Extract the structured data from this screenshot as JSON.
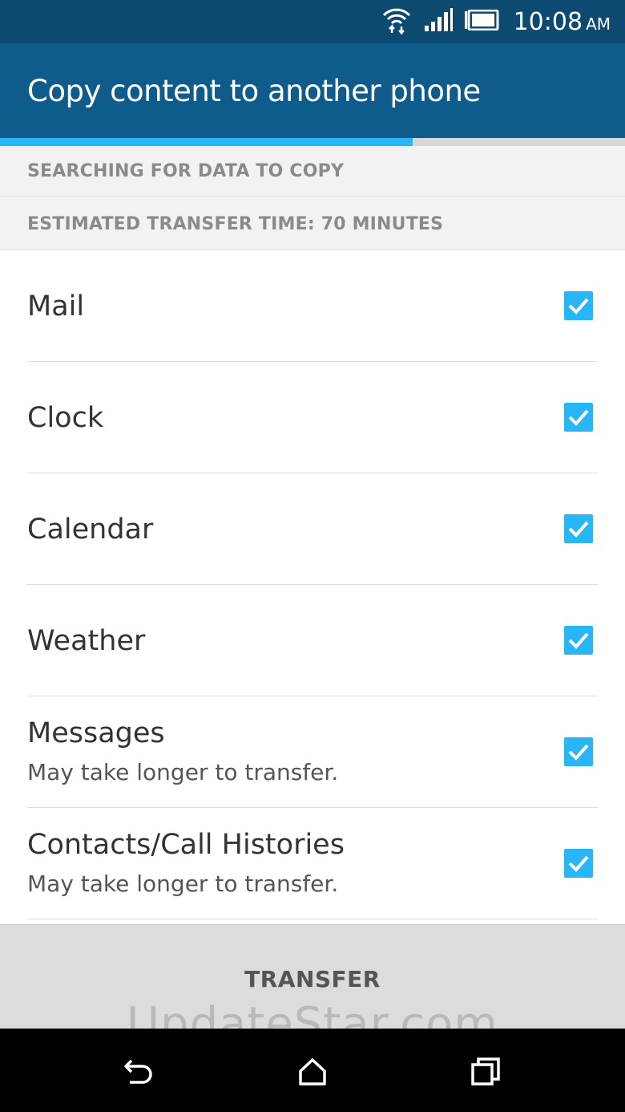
{
  "status_bar": {
    "time": "10:08",
    "ampm": "AM",
    "icons": [
      "wifi-icon",
      "signal-icon",
      "battery-icon"
    ]
  },
  "app_bar": {
    "title": "Copy content to another phone"
  },
  "progress": {
    "fraction": 0.66
  },
  "info": {
    "searching": "SEARCHING FOR DATA TO COPY",
    "estimate": "ESTIMATED TRANSFER TIME: 70 MINUTES"
  },
  "items": [
    {
      "label": "Mail",
      "subtitle": "",
      "checked": true
    },
    {
      "label": "Clock",
      "subtitle": "",
      "checked": true
    },
    {
      "label": "Calendar",
      "subtitle": "",
      "checked": true
    },
    {
      "label": "Weather",
      "subtitle": "",
      "checked": true
    },
    {
      "label": "Messages",
      "subtitle": "May take longer to transfer.",
      "checked": true
    },
    {
      "label": "Contacts/Call Histories",
      "subtitle": "May take longer to transfer.",
      "checked": true
    }
  ],
  "transfer": {
    "label": "TRANSFER"
  },
  "watermark": "UpdateStar.com",
  "nav": {
    "icons": [
      "back-icon",
      "home-icon",
      "recent-apps-icon"
    ]
  },
  "colors": {
    "status_bar": "#0d4a72",
    "app_bar": "#0f5c8c",
    "accent": "#29b6f6"
  }
}
